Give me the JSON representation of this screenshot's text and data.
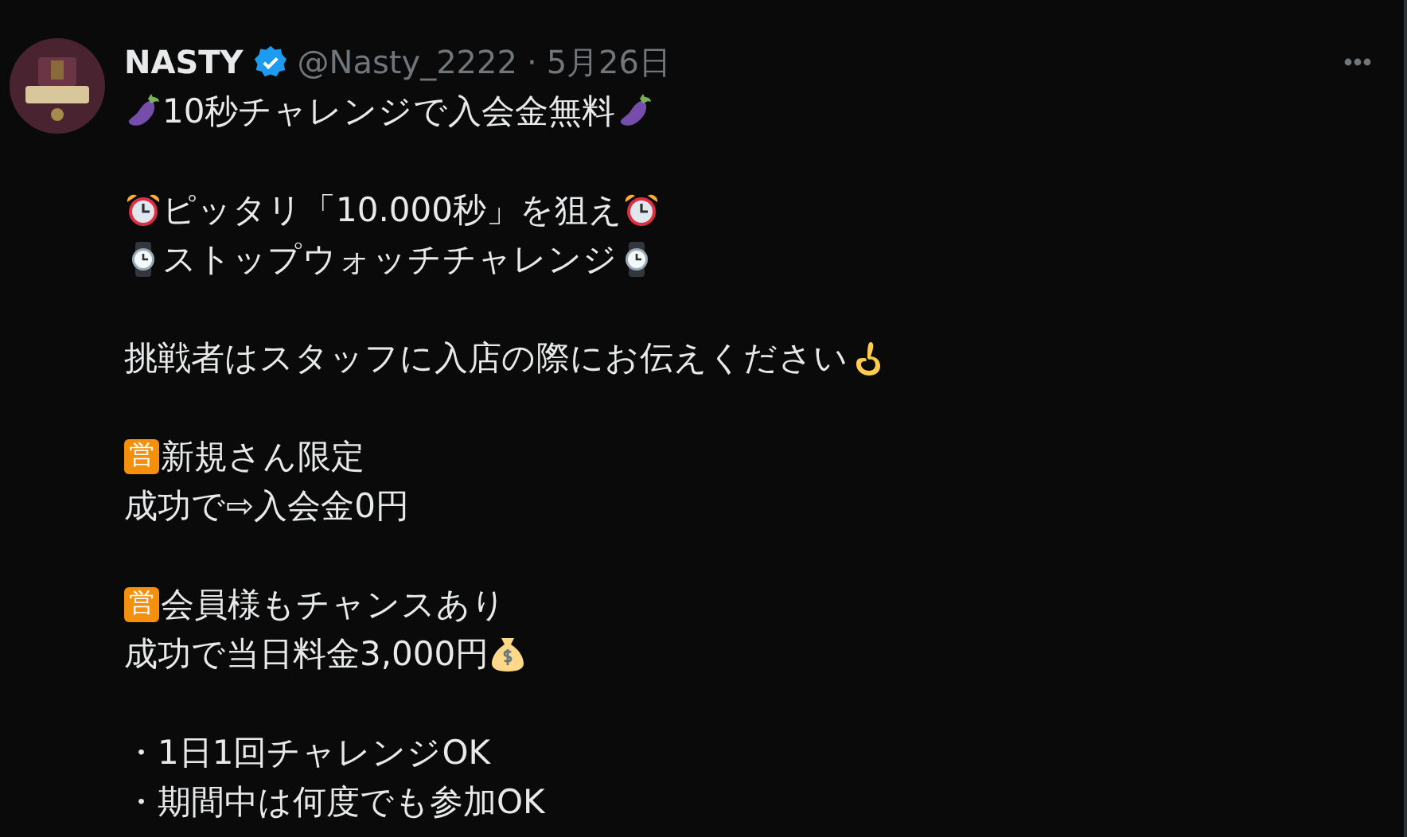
{
  "author": {
    "name": "NASTY",
    "verified": true,
    "handle": "@Nasty_2222",
    "separator": "·",
    "date": "5月26日"
  },
  "paragraphs": [
    {
      "lines": [
        [
          {
            "kind": "eggplant"
          },
          {
            "kind": "text",
            "text": "10秒チャレンジで入会金無料"
          },
          {
            "kind": "eggplant"
          }
        ]
      ]
    },
    {
      "lines": [
        [
          {
            "kind": "alarm"
          },
          {
            "kind": "text",
            "text": "ピッタリ「10.000秒」を狙え"
          },
          {
            "kind": "alarm"
          }
        ],
        [
          {
            "kind": "watch"
          },
          {
            "kind": "text",
            "text": "ストップウォッチチャレンジ"
          },
          {
            "kind": "watch"
          }
        ]
      ]
    },
    {
      "lines": [
        [
          {
            "kind": "text",
            "text": "挑戦者はスタッフに入店の際にお伝えください"
          },
          {
            "kind": "okhand"
          }
        ]
      ]
    },
    {
      "lines": [
        [
          {
            "kind": "badge",
            "text": "営"
          },
          {
            "kind": "text",
            "text": "新規さん限定"
          }
        ],
        [
          {
            "kind": "text",
            "text": "成功で⇨入会金0円"
          }
        ]
      ]
    },
    {
      "lines": [
        [
          {
            "kind": "badge",
            "text": "営"
          },
          {
            "kind": "text",
            "text": "会員様もチャンスあり"
          }
        ],
        [
          {
            "kind": "text",
            "text": "成功で当日料金3,000円"
          },
          {
            "kind": "moneybag"
          }
        ]
      ]
    },
    {
      "lines": [
        [
          {
            "kind": "text",
            "text": "・1日1回チャレンジOK"
          }
        ],
        [
          {
            "kind": "text",
            "text": "・期間中は何度でも参加OK"
          }
        ]
      ]
    }
  ]
}
